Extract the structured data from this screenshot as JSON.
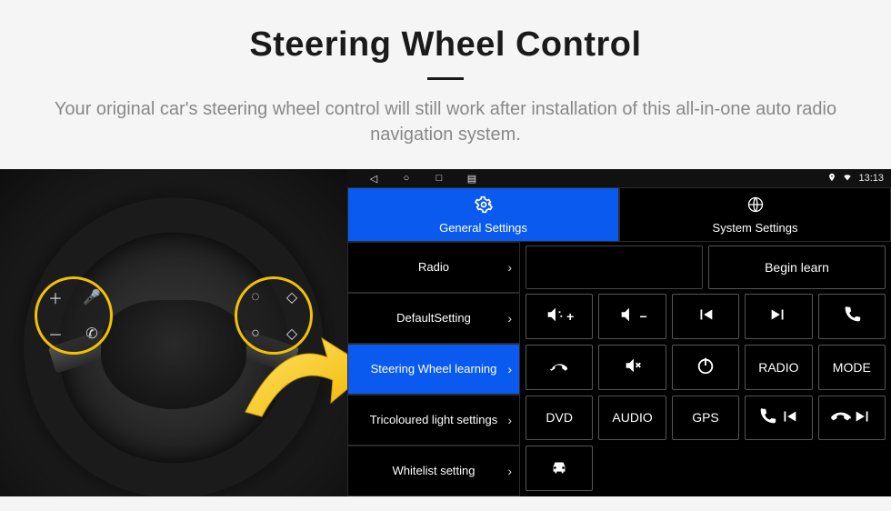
{
  "header": {
    "title": "Steering Wheel Control",
    "subtitle": "Your original car's steering wheel control will still work after installation of this all-in-one auto radio navigation system."
  },
  "statusbar": {
    "time": "13:13"
  },
  "tabs": {
    "general": "General Settings",
    "system": "System Settings"
  },
  "sidebar": {
    "items": [
      {
        "label": "Radio"
      },
      {
        "label": "DefaultSetting"
      },
      {
        "label": "Steering Wheel learning"
      },
      {
        "label": "Tricoloured light settings"
      },
      {
        "label": "Whitelist setting"
      }
    ]
  },
  "panel": {
    "begin": "Begin learn",
    "buttons": {
      "radio": "RADIO",
      "mode": "MODE",
      "dvd": "DVD",
      "audio": "AUDIO",
      "gps": "GPS"
    }
  },
  "icons": {
    "back": "back-triangle",
    "home": "circle",
    "recent": "square",
    "menu": "menu",
    "location": "location-pin",
    "wifi": "wifi",
    "gear": "gear",
    "globe": "globe"
  }
}
